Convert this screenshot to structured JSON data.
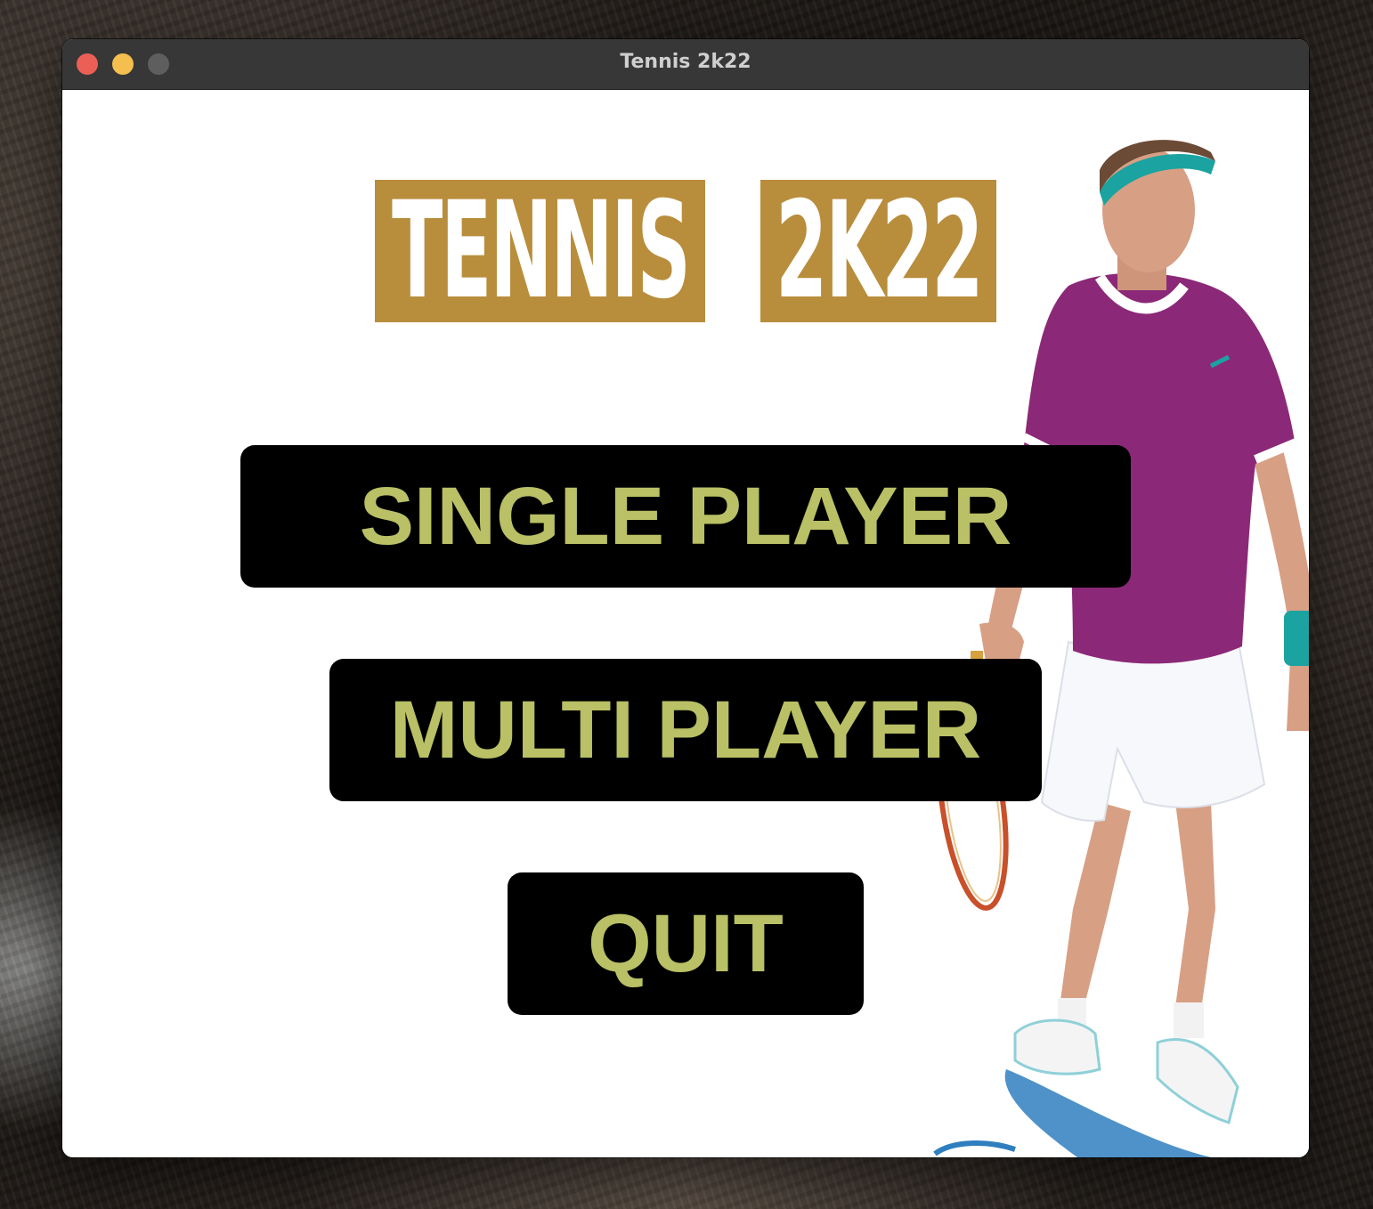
{
  "window": {
    "title": "Tennis 2k22",
    "controls": {
      "close_color": "#ec5f57",
      "minimize_color": "#f4bf4f",
      "zoom_color": "#5e5e5e"
    }
  },
  "game": {
    "logo": {
      "word1": "TENNIS",
      "word2": "2K22",
      "color": "#b88d3c"
    },
    "menu": {
      "single_player": "SINGLE PLAYER",
      "multi_player": "MULTI PLAYER",
      "quit": "QUIT"
    },
    "button_text_color": "#b9c065",
    "button_bg_color": "#000000",
    "player_image": "tennis-player"
  }
}
